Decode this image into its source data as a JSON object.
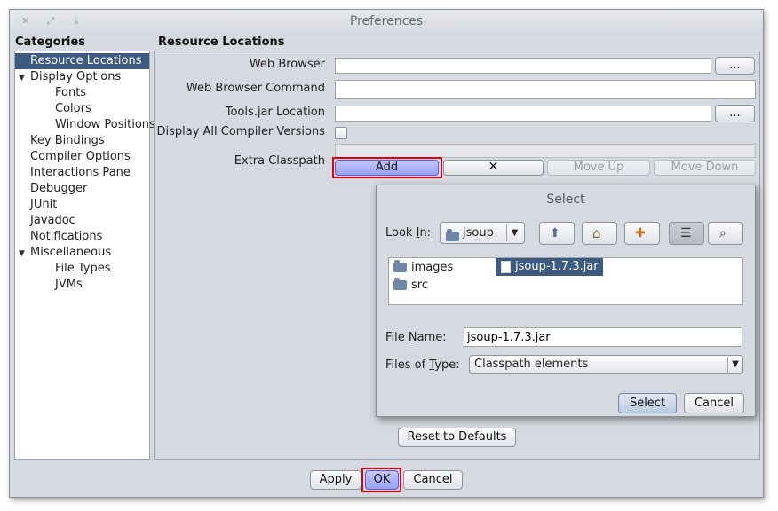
{
  "window": {
    "title": "Preferences",
    "titlebar_icons": [
      "close-icon",
      "maximize-icon",
      "minimize-icon"
    ]
  },
  "categories": {
    "heading": "Categories",
    "items": [
      {
        "label": "Resource Locations",
        "level": 0,
        "selected": true
      },
      {
        "label": "Display Options",
        "level": 0,
        "expanded": true
      },
      {
        "label": "Fonts",
        "level": 1
      },
      {
        "label": "Colors",
        "level": 1
      },
      {
        "label": "Window Positions",
        "level": 1
      },
      {
        "label": "Key Bindings",
        "level": 0
      },
      {
        "label": "Compiler Options",
        "level": 0
      },
      {
        "label": "Interactions Pane",
        "level": 0
      },
      {
        "label": "Debugger",
        "level": 0
      },
      {
        "label": "JUnit",
        "level": 0
      },
      {
        "label": "Javadoc",
        "level": 0
      },
      {
        "label": "Notifications",
        "level": 0
      },
      {
        "label": "Miscellaneous",
        "level": 0,
        "expanded": true
      },
      {
        "label": "File Types",
        "level": 1
      },
      {
        "label": "JVMs",
        "level": 1
      }
    ]
  },
  "panel": {
    "heading": "Resource Locations",
    "web_browser_label": "Web Browser",
    "web_browser_value": "",
    "web_browser_command_label": "Web Browser Command",
    "web_browser_command_value": "",
    "tools_jar_label": "Tools.jar Location",
    "tools_jar_value": "",
    "browse_label": "...",
    "compiler_versions_label": "Display All Compiler Versions",
    "compiler_versions_checked": false,
    "classpath_label": "Extra Classpath",
    "add_label": "Add",
    "remove_icon": "close-x-icon",
    "move_up_label": "Move Up",
    "move_down_label": "Move Down",
    "reset_label": "Reset to Defaults"
  },
  "select_dialog": {
    "title": "Select",
    "look_in_label": "Look In:",
    "look_in_value": "jsoup",
    "toolbar_icons": [
      "up-folder-icon",
      "home-icon",
      "new-folder-icon",
      "list-view-icon",
      "details-view-icon"
    ],
    "files": [
      {
        "name": "images",
        "type": "folder"
      },
      {
        "name": "src",
        "type": "folder"
      },
      {
        "name": "jsoup-1.7.3.jar",
        "type": "file",
        "selected": true
      }
    ],
    "file_name_label": "File Name:",
    "file_name_value": "jsoup-1.7.3.jar",
    "files_of_type_label": "Files of Type:",
    "files_of_type_value": "Classpath elements",
    "select_label": "Select",
    "cancel_label": "Cancel"
  },
  "footer": {
    "apply_label": "Apply",
    "ok_label": "OK",
    "cancel_label": "Cancel"
  },
  "colors": {
    "selection": "#3d5a80",
    "highlight_button": "#9aa0f4",
    "annotation_red": "#e00010"
  }
}
